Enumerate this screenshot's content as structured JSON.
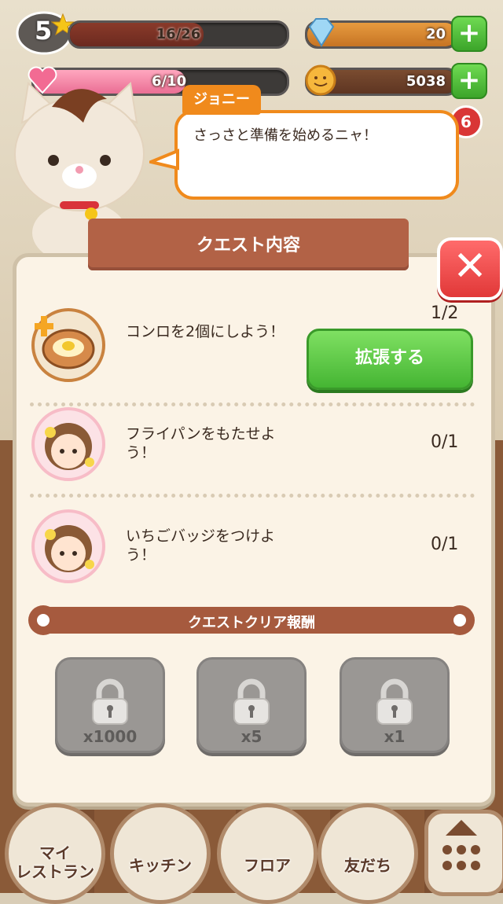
{
  "hud": {
    "level": "5",
    "exp_text": "16/26",
    "exp_fraction": 0.615,
    "stamina_text": "6/10",
    "stamina_fraction": 0.6,
    "diamonds": "20",
    "coins": "5038",
    "notification_count": "6"
  },
  "dialog": {
    "speaker": "ジョニー",
    "message": "さっさと準備を始めるニャ！"
  },
  "panel": {
    "title": "クエスト内容",
    "quests": [
      {
        "text": "コンロを2個にしよう！",
        "progress": "1/2",
        "action_label": "拡張する"
      },
      {
        "text": "フライパンをもたせよう！",
        "progress": "0/1"
      },
      {
        "text": "いちごバッジをつけよう！",
        "progress": "0/1"
      }
    ],
    "reward_title": "クエストクリア報酬",
    "rewards": [
      {
        "qty": "x1000",
        "icon": "coin-icon"
      },
      {
        "qty": "x5",
        "icon": "diamond-icon"
      },
      {
        "qty": "x1",
        "icon": "item-icon"
      }
    ]
  },
  "nav": {
    "items": [
      {
        "label": "マイ\nレストラン"
      },
      {
        "label": "キッチン"
      },
      {
        "label": "フロア"
      },
      {
        "label": "友だち"
      }
    ]
  },
  "colors": {
    "accent_orange": "#f08a1c",
    "button_green": "#4cb936",
    "close_red": "#e63b3b",
    "ribbon_brown": "#b26246"
  }
}
